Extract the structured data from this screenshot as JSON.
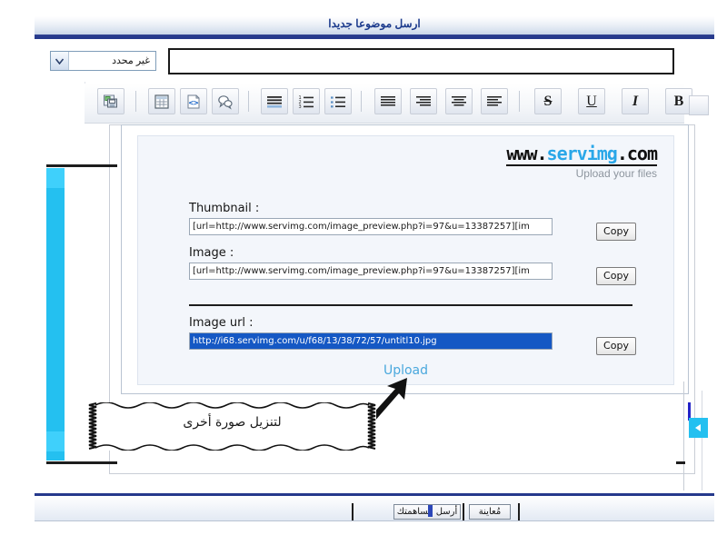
{
  "header": {
    "title": "ارسل موضوعا جديدا"
  },
  "subject": {
    "select_value": "غير محدد",
    "select_icon": "chevron-down-icon",
    "input_value": "",
    "input_placeholder": ""
  },
  "toolbar": {
    "buttons": [
      {
        "name": "save-icon",
        "glyph": ""
      },
      {
        "name": "table-icon",
        "glyph": ""
      },
      {
        "name": "code-icon",
        "glyph": ""
      },
      {
        "name": "quote-icon",
        "glyph": ""
      },
      {
        "name": "indent-icon",
        "glyph": ""
      },
      {
        "name": "ordered-list-icon",
        "glyph": ""
      },
      {
        "name": "unordered-list-icon",
        "glyph": ""
      },
      {
        "name": "align-justify-icon",
        "glyph": ""
      },
      {
        "name": "align-right-icon",
        "glyph": ""
      },
      {
        "name": "align-center-icon",
        "glyph": ""
      },
      {
        "name": "align-left-icon",
        "glyph": ""
      },
      {
        "name": "strikethrough-button",
        "glyph": "S"
      },
      {
        "name": "underline-button",
        "glyph": "U"
      },
      {
        "name": "italic-button",
        "glyph": "I"
      },
      {
        "name": "bold-button",
        "glyph": "B"
      }
    ]
  },
  "servimg": {
    "logo": {
      "www": "www.",
      "name": "servimg",
      "com": ".com",
      "tagline": "Upload your files"
    },
    "fields": [
      {
        "label": "Thumbnail :",
        "value": "[url=http://www.servimg.com/image_preview.php?i=97&u=13387257][im",
        "copy_label": "Copy",
        "selected": false
      },
      {
        "label": "Image :",
        "value": "[url=http://www.servimg.com/image_preview.php?i=97&u=13387257][im",
        "copy_label": "Copy",
        "selected": false
      },
      {
        "label": "Image url :",
        "value": "http://i68.servimg.com/u/f68/13/38/72/57/untitl10.jpg",
        "copy_label": "Copy",
        "selected": true
      }
    ],
    "upload_link": "Upload"
  },
  "annotation": {
    "note_text": "لتنزيل صورة أخرى",
    "arrow": "arrow-up-right"
  },
  "side_widget": {
    "button_icon": "triangle-left-icon"
  },
  "bottom": {
    "send_label": "أرسل مساهمتك",
    "preview_label": "مُعاينة"
  },
  "colors": {
    "header_text": "#1b3a8c",
    "accent_blue": "#25398c",
    "cyan": "#24c0f0",
    "logo_blue": "#2aa7e8",
    "selection_blue": "#1558c4",
    "upload_link": "#4aa8dd"
  }
}
